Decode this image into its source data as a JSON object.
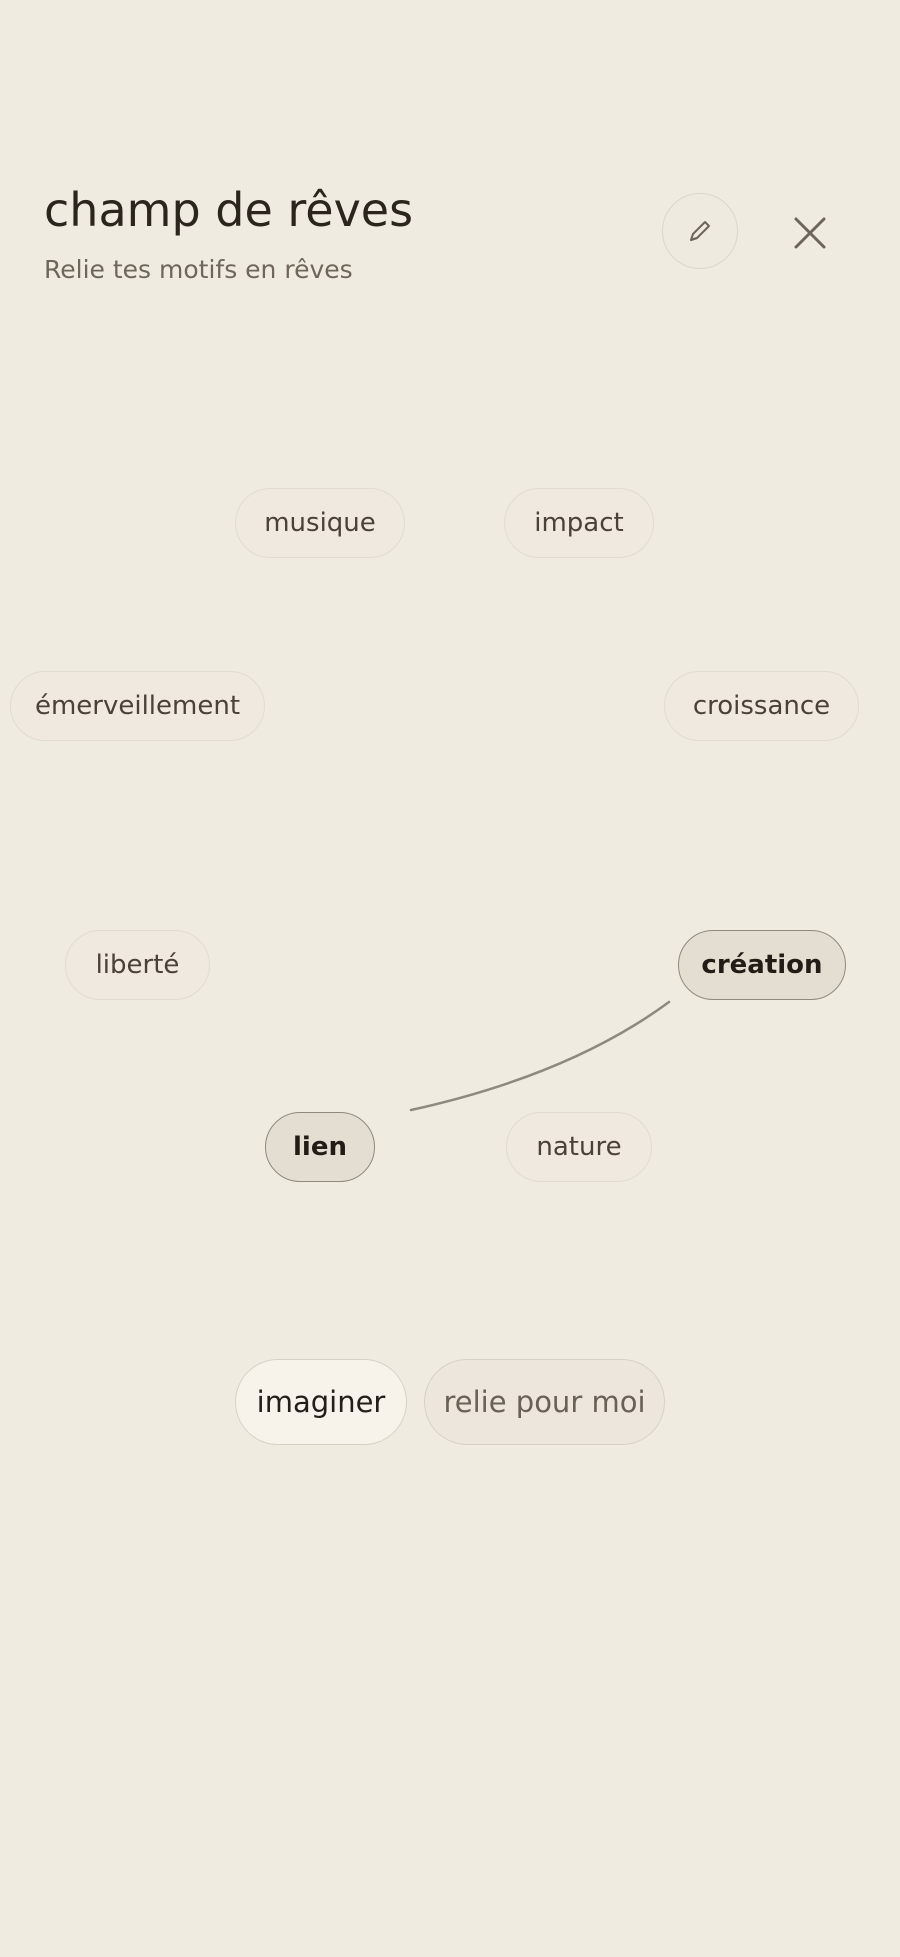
{
  "header": {
    "title": "champ de rêves",
    "subtitle": "Relie tes motifs en rêves",
    "edit_icon": "pencil-icon",
    "close_icon": "close-icon"
  },
  "words": [
    {
      "label": "musique",
      "selected": false
    },
    {
      "label": "impact",
      "selected": false
    },
    {
      "label": "émerveillement",
      "selected": false
    },
    {
      "label": "croissance",
      "selected": false
    },
    {
      "label": "liberté",
      "selected": false
    },
    {
      "label": "création",
      "selected": true
    },
    {
      "label": "lien",
      "selected": true
    },
    {
      "label": "nature",
      "selected": false
    }
  ],
  "actions": {
    "primary_label": "imaginer",
    "secondary_label": "relie pour moi"
  },
  "colors": {
    "background": "#f0ebe1",
    "text": "#2b251e",
    "muted": "#6f665b",
    "selected_border": "#8f887d",
    "connection_line": "#8e887e"
  }
}
